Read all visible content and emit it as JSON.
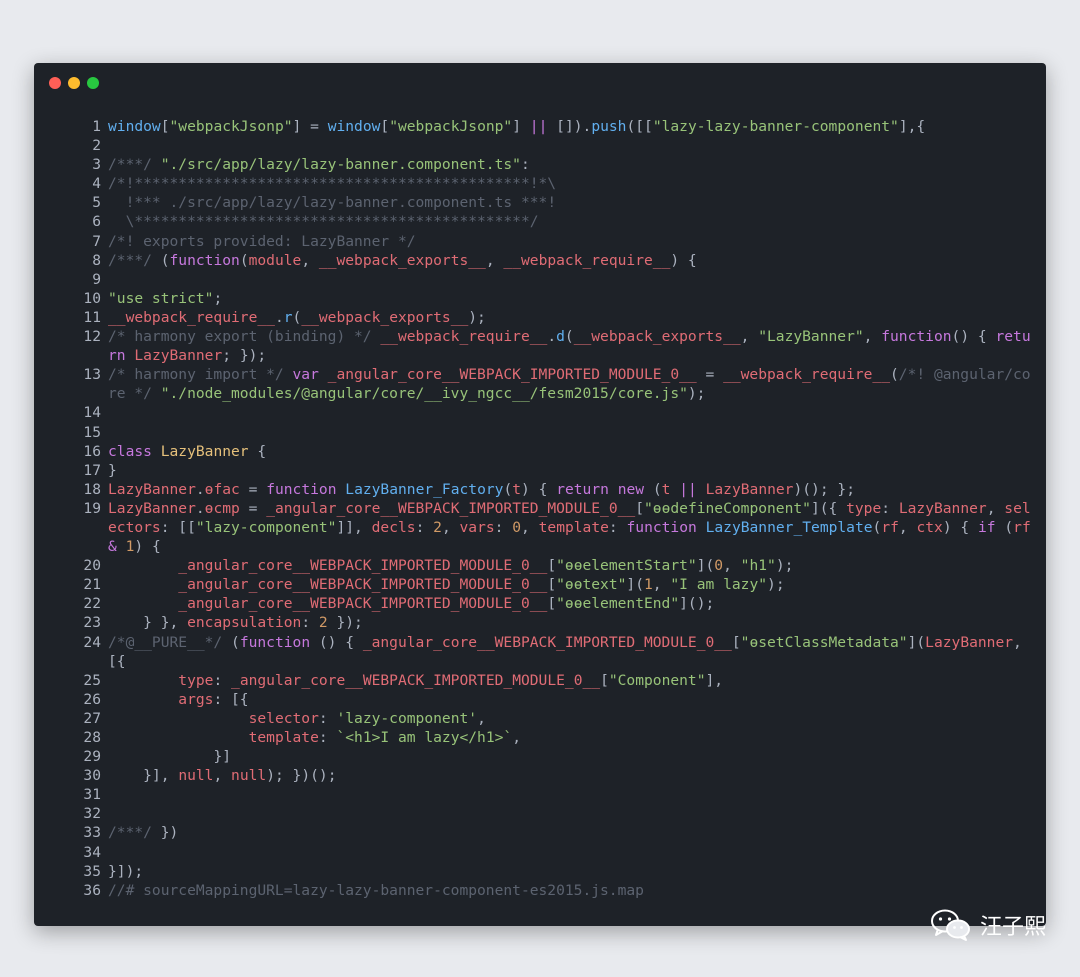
{
  "window": {
    "controls": [
      "close",
      "minimize",
      "maximize"
    ]
  },
  "code": {
    "lines": [
      {
        "n": "1",
        "t": [
          [
            "window",
            "f"
          ],
          [
            "[",
            ""
          ],
          [
            "\"webpackJsonp\"",
            "s"
          ],
          [
            "] = ",
            ""
          ],
          [
            "window",
            "f"
          ],
          [
            "[",
            ""
          ],
          [
            "\"webpackJsonp\"",
            "s"
          ],
          [
            "] ",
            ""
          ],
          [
            "||",
            "k"
          ],
          [
            " []).",
            ""
          ],
          [
            "push",
            "f"
          ],
          [
            "([[",
            ""
          ],
          [
            "\"lazy-lazy-banner-component\"",
            "s"
          ],
          [
            "],{",
            ""
          ]
        ]
      },
      {
        "n": "2",
        "t": []
      },
      {
        "n": "3",
        "t": [
          [
            "/***/ ",
            "c"
          ],
          [
            "\"./src/app/lazy/lazy-banner.component.ts\"",
            "s"
          ],
          [
            ":",
            ""
          ]
        ]
      },
      {
        "n": "4",
        "t": [
          [
            "/*!*********************************************!*\\",
            "c"
          ]
        ]
      },
      {
        "n": "5",
        "t": [
          [
            "  !*** ./src/app/lazy/lazy-banner.component.ts ***!",
            "c"
          ]
        ]
      },
      {
        "n": "6",
        "t": [
          [
            "  \\*********************************************/",
            "c"
          ]
        ]
      },
      {
        "n": "7",
        "t": [
          [
            "/*! exports provided: LazyBanner */",
            "c"
          ]
        ]
      },
      {
        "n": "8",
        "t": [
          [
            "/***/ ",
            "c"
          ],
          [
            "(",
            ""
          ],
          [
            "function",
            "k"
          ],
          [
            "(",
            ""
          ],
          [
            "module",
            "v"
          ],
          [
            ", ",
            ""
          ],
          [
            "__webpack_exports__",
            "v"
          ],
          [
            ", ",
            ""
          ],
          [
            "__webpack_require__",
            "v"
          ],
          [
            ") {",
            ""
          ]
        ]
      },
      {
        "n": "9",
        "t": []
      },
      {
        "n": "10",
        "t": [
          [
            "\"use strict\"",
            "s"
          ],
          [
            ";",
            ""
          ]
        ]
      },
      {
        "n": "11",
        "t": [
          [
            "__webpack_require__",
            "v"
          ],
          [
            ".",
            ""
          ],
          [
            "r",
            "f"
          ],
          [
            "(",
            ""
          ],
          [
            "__webpack_exports__",
            "v"
          ],
          [
            ");",
            ""
          ]
        ]
      },
      {
        "n": "12",
        "t": [
          [
            "/* harmony export (binding) */ ",
            "c"
          ],
          [
            "__webpack_require__",
            "v"
          ],
          [
            ".",
            ""
          ],
          [
            "d",
            "f"
          ],
          [
            "(",
            ""
          ],
          [
            "__webpack_exports__",
            "v"
          ],
          [
            ", ",
            ""
          ],
          [
            "\"LazyBanner\"",
            "s"
          ],
          [
            ", ",
            ""
          ],
          [
            "function",
            "k"
          ],
          [
            "() { ",
            ""
          ],
          [
            "return",
            "k"
          ],
          [
            " ",
            ""
          ],
          [
            "LazyBanner",
            "v"
          ],
          [
            "; });",
            ""
          ]
        ]
      },
      {
        "n": "13",
        "t": [
          [
            "/* harmony import */ ",
            "c"
          ],
          [
            "var",
            "k"
          ],
          [
            " ",
            ""
          ],
          [
            "_angular_core__WEBPACK_IMPORTED_MODULE_0__",
            "v"
          ],
          [
            " = ",
            ""
          ],
          [
            "__webpack_require__",
            "v"
          ],
          [
            "(",
            ""
          ],
          [
            "/*! @angular/core */ ",
            "c"
          ],
          [
            "\"./node_modules/@angular/core/__ivy_ngcc__/fesm2015/core.js\"",
            "s"
          ],
          [
            ");",
            ""
          ]
        ]
      },
      {
        "n": "14",
        "t": []
      },
      {
        "n": "15",
        "t": []
      },
      {
        "n": "16",
        "t": [
          [
            "class",
            "k"
          ],
          [
            " ",
            ""
          ],
          [
            "LazyBanner",
            "y"
          ],
          [
            " {",
            ""
          ]
        ]
      },
      {
        "n": "17",
        "t": [
          [
            "}",
            ""
          ]
        ]
      },
      {
        "n": "18",
        "t": [
          [
            "LazyBanner",
            "v"
          ],
          [
            ".",
            ""
          ],
          [
            "ɵfac",
            "v"
          ],
          [
            " = ",
            ""
          ],
          [
            "function",
            "k"
          ],
          [
            " ",
            ""
          ],
          [
            "LazyBanner_Factory",
            "f"
          ],
          [
            "(",
            ""
          ],
          [
            "t",
            "v"
          ],
          [
            ") { ",
            ""
          ],
          [
            "return",
            "k"
          ],
          [
            " ",
            ""
          ],
          [
            "new",
            "k"
          ],
          [
            " (",
            ""
          ],
          [
            "t",
            "v"
          ],
          [
            " ",
            ""
          ],
          [
            "||",
            "k"
          ],
          [
            " ",
            ""
          ],
          [
            "LazyBanner",
            "v"
          ],
          [
            ")(); };",
            ""
          ]
        ]
      },
      {
        "n": "19",
        "t": [
          [
            "LazyBanner",
            "v"
          ],
          [
            ".",
            ""
          ],
          [
            "ɵcmp",
            "v"
          ],
          [
            " = ",
            ""
          ],
          [
            "_angular_core__WEBPACK_IMPORTED_MODULE_0__",
            "v"
          ],
          [
            "[",
            ""
          ],
          [
            "\"ɵɵdefineComponent\"",
            "s"
          ],
          [
            "]({ ",
            ""
          ],
          [
            "type",
            "v"
          ],
          [
            ": ",
            ""
          ],
          [
            "LazyBanner",
            "v"
          ],
          [
            ", ",
            ""
          ],
          [
            "selectors",
            "v"
          ],
          [
            ": [[",
            ""
          ],
          [
            "\"lazy-component\"",
            "s"
          ],
          [
            "]], ",
            ""
          ],
          [
            "decls",
            "v"
          ],
          [
            ": ",
            ""
          ],
          [
            "2",
            "n"
          ],
          [
            ", ",
            ""
          ],
          [
            "vars",
            "v"
          ],
          [
            ": ",
            ""
          ],
          [
            "0",
            "n"
          ],
          [
            ", ",
            ""
          ],
          [
            "template",
            "v"
          ],
          [
            ": ",
            ""
          ],
          [
            "function",
            "k"
          ],
          [
            " ",
            ""
          ],
          [
            "LazyBanner_Template",
            "f"
          ],
          [
            "(",
            ""
          ],
          [
            "rf",
            "v"
          ],
          [
            ", ",
            ""
          ],
          [
            "ctx",
            "v"
          ],
          [
            ") { ",
            ""
          ],
          [
            "if",
            "k"
          ],
          [
            " (",
            ""
          ],
          [
            "rf",
            "v"
          ],
          [
            " ",
            ""
          ],
          [
            "&",
            "k"
          ],
          [
            " ",
            ""
          ],
          [
            "1",
            "n"
          ],
          [
            ") {",
            ""
          ]
        ]
      },
      {
        "n": "20",
        "t": [
          [
            "        ",
            ""
          ],
          [
            "_angular_core__WEBPACK_IMPORTED_MODULE_0__",
            "v"
          ],
          [
            "[",
            ""
          ],
          [
            "\"ɵɵelementStart\"",
            "s"
          ],
          [
            "](",
            ""
          ],
          [
            "0",
            "n"
          ],
          [
            ", ",
            ""
          ],
          [
            "\"h1\"",
            "s"
          ],
          [
            ");",
            ""
          ]
        ]
      },
      {
        "n": "21",
        "t": [
          [
            "        ",
            ""
          ],
          [
            "_angular_core__WEBPACK_IMPORTED_MODULE_0__",
            "v"
          ],
          [
            "[",
            ""
          ],
          [
            "\"ɵɵtext\"",
            "s"
          ],
          [
            "](",
            ""
          ],
          [
            "1",
            "n"
          ],
          [
            ", ",
            ""
          ],
          [
            "\"I am lazy\"",
            "s"
          ],
          [
            ");",
            ""
          ]
        ]
      },
      {
        "n": "22",
        "t": [
          [
            "        ",
            ""
          ],
          [
            "_angular_core__WEBPACK_IMPORTED_MODULE_0__",
            "v"
          ],
          [
            "[",
            ""
          ],
          [
            "\"ɵɵelementEnd\"",
            "s"
          ],
          [
            "]();",
            ""
          ]
        ]
      },
      {
        "n": "23",
        "t": [
          [
            "    } }, ",
            ""
          ],
          [
            "encapsulation",
            "v"
          ],
          [
            ": ",
            ""
          ],
          [
            "2",
            "n"
          ],
          [
            " });",
            ""
          ]
        ]
      },
      {
        "n": "24",
        "t": [
          [
            "/*@__PURE__*/ ",
            "c"
          ],
          [
            "(",
            ""
          ],
          [
            "function",
            "k"
          ],
          [
            " () { ",
            ""
          ],
          [
            "_angular_core__WEBPACK_IMPORTED_MODULE_0__",
            "v"
          ],
          [
            "[",
            ""
          ],
          [
            "\"ɵsetClassMetadata\"",
            "s"
          ],
          [
            "](",
            ""
          ],
          [
            "LazyBanner",
            "v"
          ],
          [
            ", [{",
            ""
          ]
        ]
      },
      {
        "n": "25",
        "t": [
          [
            "        ",
            ""
          ],
          [
            "type",
            "v"
          ],
          [
            ": ",
            ""
          ],
          [
            "_angular_core__WEBPACK_IMPORTED_MODULE_0__",
            "v"
          ],
          [
            "[",
            ""
          ],
          [
            "\"Component\"",
            "s"
          ],
          [
            "],",
            ""
          ]
        ]
      },
      {
        "n": "26",
        "t": [
          [
            "        ",
            ""
          ],
          [
            "args",
            "v"
          ],
          [
            ": [{",
            ""
          ]
        ]
      },
      {
        "n": "27",
        "t": [
          [
            "                ",
            ""
          ],
          [
            "selector",
            "v"
          ],
          [
            ": ",
            ""
          ],
          [
            "'lazy-component'",
            "s"
          ],
          [
            ",",
            ""
          ]
        ]
      },
      {
        "n": "28",
        "t": [
          [
            "                ",
            ""
          ],
          [
            "template",
            "v"
          ],
          [
            ": ",
            ""
          ],
          [
            "`<h1>I am lazy</h1>`",
            "s"
          ],
          [
            ",",
            ""
          ]
        ]
      },
      {
        "n": "29",
        "t": [
          [
            "            }]",
            ""
          ]
        ]
      },
      {
        "n": "30",
        "t": [
          [
            "    }], ",
            ""
          ],
          [
            "null",
            "v"
          ],
          [
            ", ",
            ""
          ],
          [
            "null",
            "v"
          ],
          [
            "); })();",
            ""
          ]
        ]
      },
      {
        "n": "31",
        "t": []
      },
      {
        "n": "32",
        "t": []
      },
      {
        "n": "33",
        "t": [
          [
            "/***/ ",
            "c"
          ],
          [
            "})",
            ""
          ]
        ]
      },
      {
        "n": "34",
        "t": []
      },
      {
        "n": "35",
        "t": [
          [
            "}]);",
            ""
          ]
        ]
      },
      {
        "n": "36",
        "t": [
          [
            "//# sourceMappingURL=lazy-lazy-banner-component-es2015.js.map",
            "c"
          ]
        ]
      }
    ]
  },
  "watermark": {
    "icon": "wechat-icon",
    "text": "汪子熙"
  }
}
